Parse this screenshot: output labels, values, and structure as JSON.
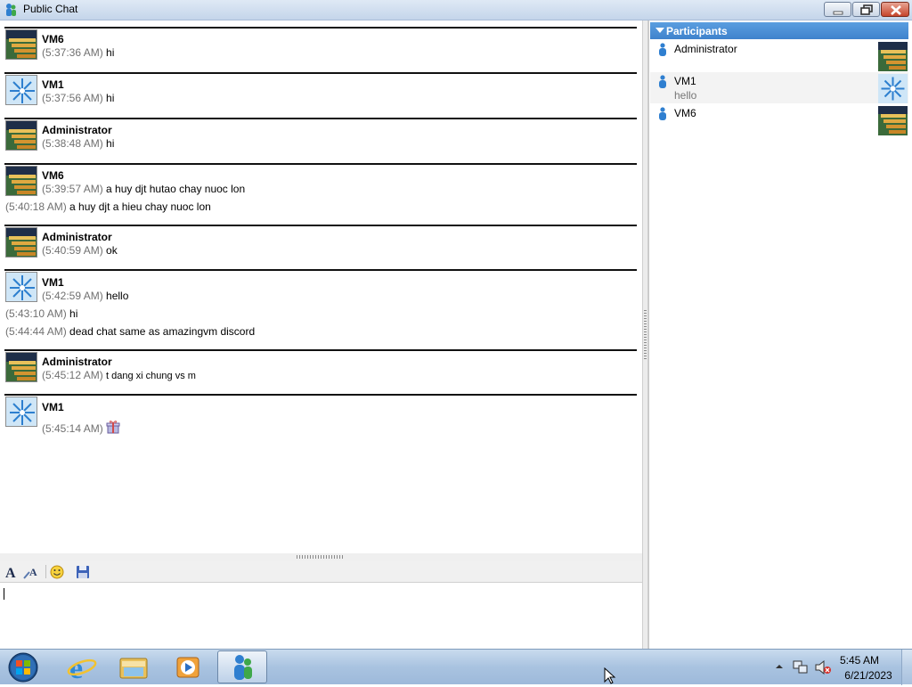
{
  "window": {
    "title": "Public Chat",
    "controls": {
      "minimize": "minimize",
      "maximize": "restore",
      "close": "close"
    }
  },
  "chat": {
    "blocks": [
      {
        "sender": "VM6",
        "avatar": "ladder-avatar",
        "lines": [
          {
            "time": "(5:37:36 AM)",
            "text": "hi"
          }
        ]
      },
      {
        "sender": "VM1",
        "avatar": "pinwheel-avatar",
        "lines": [
          {
            "time": "(5:37:56 AM)",
            "text": "hi"
          }
        ]
      },
      {
        "sender": "Administrator",
        "avatar": "ladder-avatar",
        "lines": [
          {
            "time": "(5:38:48 AM)",
            "text": "hi"
          }
        ]
      },
      {
        "sender": "VM6",
        "avatar": "ladder-avatar",
        "lines": [
          {
            "time": "(5:39:57 AM)",
            "text": "a huy djt hutao chay nuoc lon"
          },
          {
            "time": "(5:40:18 AM)",
            "text": "a huy djt a hieu chay nuoc lon"
          }
        ]
      },
      {
        "sender": "Administrator",
        "avatar": "ladder-avatar",
        "lines": [
          {
            "time": "(5:40:59 AM)",
            "text": "ok"
          }
        ]
      },
      {
        "sender": "VM1",
        "avatar": "pinwheel-avatar",
        "lines": [
          {
            "time": "(5:42:59 AM)",
            "text": "hello"
          },
          {
            "time": "(5:43:10 AM)",
            "text": "hi"
          },
          {
            "time": "(5:44:44 AM)",
            "text": "dead chat same as amazingvm discord"
          }
        ]
      },
      {
        "sender": "Administrator",
        "avatar": "ladder-avatar",
        "lines": [
          {
            "time": "(5:45:12 AM)",
            "text": "t dang xi chung vs m"
          }
        ]
      },
      {
        "sender": "VM1",
        "avatar": "pinwheel-avatar",
        "lines": [
          {
            "time": "(5:45:14 AM)",
            "text": "",
            "emoticon": "gift-icon"
          }
        ]
      }
    ]
  },
  "toolbar": {
    "items": [
      "font-icon",
      "font-color-icon",
      "emoticon-icon",
      "save-icon"
    ]
  },
  "input": {
    "value": ""
  },
  "participants": {
    "header": "Participants",
    "items": [
      {
        "name": "Administrator",
        "status": "",
        "avatar": "ladder-avatar"
      },
      {
        "name": "VM1",
        "status": "hello",
        "avatar": "pinwheel-avatar"
      },
      {
        "name": "VM6",
        "status": "",
        "avatar": "ladder-avatar"
      }
    ]
  },
  "taskbar": {
    "apps": [
      "start-orb",
      "internet-explorer-icon",
      "windows-explorer-icon",
      "media-player-icon",
      "messenger-icon"
    ],
    "active_app": "messenger-icon",
    "clock": {
      "time": "5:45 AM",
      "date": "6/21/2023"
    }
  }
}
